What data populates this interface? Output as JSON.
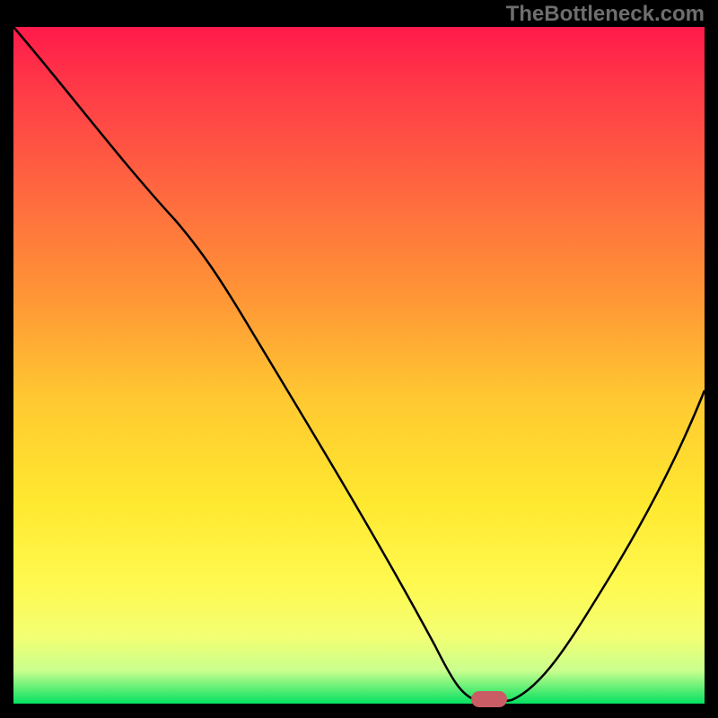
{
  "watermark": "TheBottleneck.com",
  "marker_color": "#ca5c66",
  "chart_data": {
    "type": "line",
    "title": "",
    "xlabel": "",
    "ylabel": "",
    "xlim": [
      0,
      100
    ],
    "ylim": [
      0,
      100
    ],
    "x": [
      0,
      5,
      10,
      15,
      20,
      25,
      30,
      35,
      40,
      45,
      50,
      55,
      60,
      65,
      68,
      70,
      75,
      80,
      85,
      90,
      95,
      100
    ],
    "values": [
      100,
      93,
      86,
      79,
      72,
      66,
      59,
      51,
      43,
      34,
      26,
      17,
      9,
      2,
      0,
      0,
      3,
      10,
      19,
      28,
      37,
      47
    ],
    "marker_x": 69,
    "marker_y": 0,
    "gradient_stops": [
      {
        "pos": 0,
        "color": "#ff1a4a"
      },
      {
        "pos": 40,
        "color": "#ff9636"
      },
      {
        "pos": 70,
        "color": "#ffe82f"
      },
      {
        "pos": 100,
        "color": "#00e060"
      }
    ],
    "legend": null
  }
}
